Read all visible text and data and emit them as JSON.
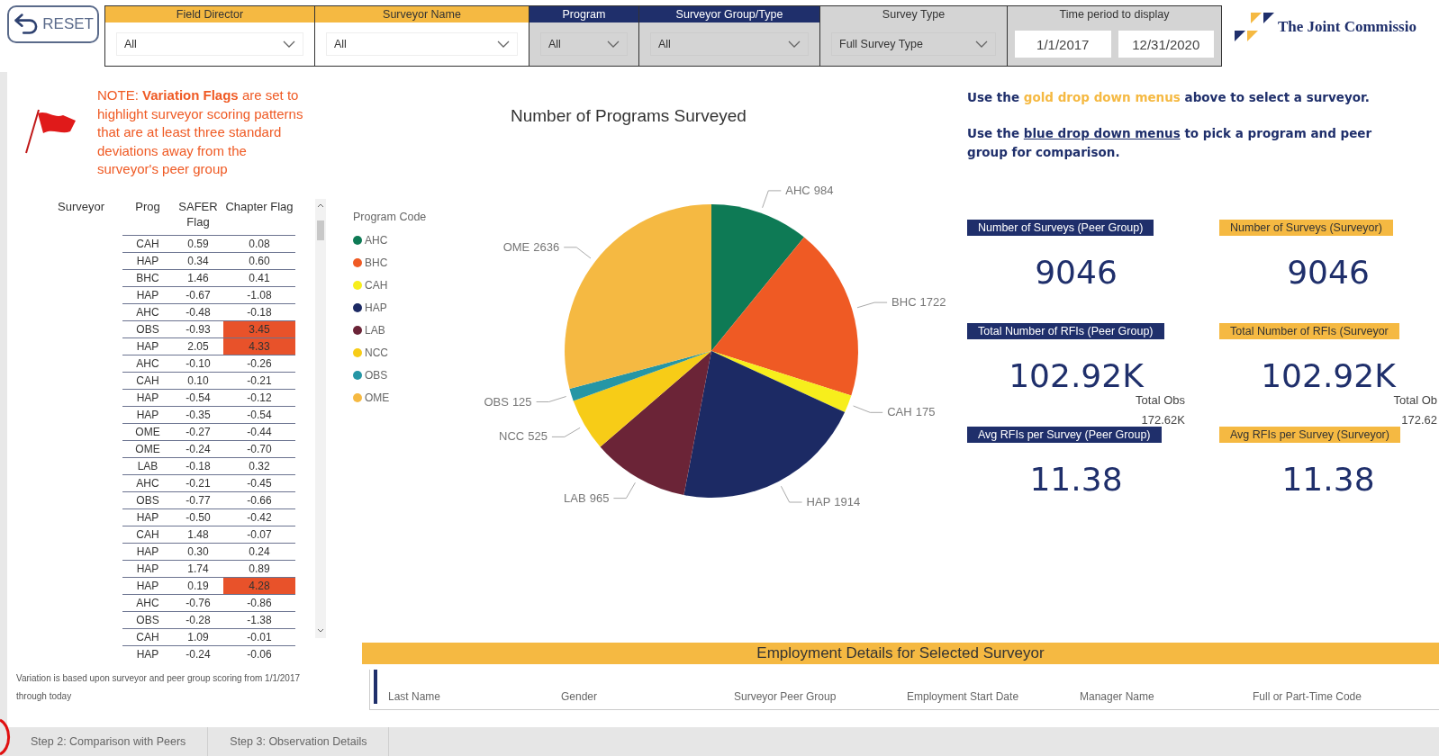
{
  "reset_button": {
    "label": "RESET"
  },
  "filters": [
    {
      "label": "Field Director",
      "kind": "gold",
      "value": "All"
    },
    {
      "label": "Surveyor Name",
      "kind": "gold",
      "value": "All"
    },
    {
      "label": "Program",
      "kind": "blue",
      "value": "All"
    },
    {
      "label": "Surveyor Group/Type",
      "kind": "blue",
      "value": "All"
    },
    {
      "label": "Survey Type",
      "kind": "plain",
      "value": "Full Survey Type"
    }
  ],
  "time_period": {
    "label": "Time period to display",
    "start": "1/1/2017",
    "end": "12/31/2020"
  },
  "logo": {
    "text": "The Joint Commissio"
  },
  "note": {
    "text": "NOTE: **Variation Flags** are set to highlight surveyor scoring patterns that are at least three standard deviations away from the surveyor's peer group"
  },
  "flag_table": {
    "columns": [
      "Surveyor",
      "Prog",
      "SAFER Flag",
      "Chapter Flag"
    ],
    "rows": [
      {
        "prog": "CAH",
        "safer": "0.59",
        "chapter": "0.08",
        "chapter_flagged": false
      },
      {
        "prog": "HAP",
        "safer": "0.34",
        "chapter": "0.60",
        "chapter_flagged": false
      },
      {
        "prog": "BHC",
        "safer": "1.46",
        "chapter": "0.41",
        "chapter_flagged": false
      },
      {
        "prog": "HAP",
        "safer": "-0.67",
        "chapter": "-1.08",
        "chapter_flagged": false
      },
      {
        "prog": "AHC",
        "safer": "-0.48",
        "chapter": "-0.18",
        "chapter_flagged": false
      },
      {
        "prog": "OBS",
        "safer": "-0.93",
        "chapter": "3.45",
        "chapter_flagged": true
      },
      {
        "prog": "HAP",
        "safer": "2.05",
        "chapter": "4.33",
        "chapter_flagged": true
      },
      {
        "prog": "AHC",
        "safer": "-0.10",
        "chapter": "-0.26",
        "chapter_flagged": false
      },
      {
        "prog": "CAH",
        "safer": "0.10",
        "chapter": "-0.21",
        "chapter_flagged": false
      },
      {
        "prog": "HAP",
        "safer": "-0.54",
        "chapter": "-0.12",
        "chapter_flagged": false
      },
      {
        "prog": "HAP",
        "safer": "-0.35",
        "chapter": "-0.54",
        "chapter_flagged": false
      },
      {
        "prog": "OME",
        "safer": "-0.27",
        "chapter": "-0.44",
        "chapter_flagged": false
      },
      {
        "prog": "OME",
        "safer": "-0.24",
        "chapter": "-0.70",
        "chapter_flagged": false
      },
      {
        "prog": "LAB",
        "safer": "-0.18",
        "chapter": "0.32",
        "chapter_flagged": false
      },
      {
        "prog": "AHC",
        "safer": "-0.21",
        "chapter": "-0.45",
        "chapter_flagged": false
      },
      {
        "prog": "OBS",
        "safer": "-0.77",
        "chapter": "-0.66",
        "chapter_flagged": false
      },
      {
        "prog": "HAP",
        "safer": "-0.50",
        "chapter": "-0.42",
        "chapter_flagged": false
      },
      {
        "prog": "CAH",
        "safer": "1.48",
        "chapter": "-0.07",
        "chapter_flagged": false
      },
      {
        "prog": "HAP",
        "safer": "0.30",
        "chapter": "0.24",
        "chapter_flagged": false
      },
      {
        "prog": "HAP",
        "safer": "1.74",
        "chapter": "0.89",
        "chapter_flagged": false
      },
      {
        "prog": "HAP",
        "safer": "0.19",
        "chapter": "4.28",
        "chapter_flagged": true
      },
      {
        "prog": "AHC",
        "safer": "-0.76",
        "chapter": "-0.86",
        "chapter_flagged": false
      },
      {
        "prog": "OBS",
        "safer": "-0.28",
        "chapter": "-1.38",
        "chapter_flagged": false
      },
      {
        "prog": "CAH",
        "safer": "1.09",
        "chapter": "-0.01",
        "chapter_flagged": false
      },
      {
        "prog": "HAP",
        "safer": "-0.24",
        "chapter": "-0.06",
        "chapter_flagged": false
      }
    ]
  },
  "footnote": "Variation is based upon surveyor and peer group scoring from 1/1/2017 through today",
  "chart": {
    "legend_title": "Program Code",
    "legend": [
      {
        "label": "AHC",
        "color": "#0e7a55"
      },
      {
        "label": "BHC",
        "color": "#ef5a24"
      },
      {
        "label": "CAH",
        "color": "#f7ee1c"
      },
      {
        "label": "HAP",
        "color": "#1c2a64"
      },
      {
        "label": "LAB",
        "color": "#6b2437"
      },
      {
        "label": "NCC",
        "color": "#f7cc17"
      },
      {
        "label": "OBS",
        "color": "#2596a5"
      },
      {
        "label": "OME",
        "color": "#f5b942"
      }
    ],
    "chart_data": {
      "type": "pie",
      "title": "Number of Programs Surveyed",
      "categories": [
        "AHC",
        "BHC",
        "CAH",
        "HAP",
        "LAB",
        "NCC",
        "OBS",
        "OME"
      ],
      "values": [
        984,
        1722,
        175,
        1914,
        965,
        525,
        125,
        2636
      ],
      "data_labels": true
    }
  },
  "instructions": [
    {
      "parts": [
        {
          "kind": "plain",
          "text": "Use the "
        },
        {
          "kind": "gold",
          "text": "gold drop down menus"
        },
        {
          "kind": "plain",
          "text": " above to select a surveyor."
        }
      ]
    },
    {
      "parts": [
        {
          "kind": "plain",
          "text": "Use the "
        },
        {
          "kind": "link",
          "text": "blue drop down menus"
        },
        {
          "kind": "plain",
          "text": " to pick a program and peer group for comparison."
        }
      ]
    }
  ],
  "kpis": [
    {
      "label": "Number of Surveys (Peer Group)",
      "kind": "peer",
      "value": "9046"
    },
    {
      "label": "Number of Surveys (Surveyor)",
      "kind": "surveyor",
      "value": "9046"
    },
    {
      "label": "Total Number of RFIs (Peer Group)",
      "kind": "peer",
      "value": "102.92K",
      "sub_label": "Total Obs",
      "sub_value": "172.62K"
    },
    {
      "label": "Total Number of RFIs (Surveyor",
      "kind": "surveyor",
      "value": "102.92K",
      "sub_label": "Total Ob",
      "sub_value": "172.62"
    },
    {
      "label": "Avg RFIs per Survey (Peer Group)",
      "kind": "peer",
      "value": "11.38"
    },
    {
      "label": "Avg RFIs per Survey (Surveyor)",
      "kind": "surveyor",
      "value": "11.38"
    }
  ],
  "employment": {
    "title": "Employment Details for Selected Surveyor",
    "columns": [
      "Last Name",
      "Gender",
      "Surveyor Peer Group",
      "Employment Start Date",
      "Manager Name",
      "Full or Part-Time Code"
    ]
  },
  "tabs": [
    {
      "label": "Step 2: Comparison with Peers",
      "selected": false
    },
    {
      "label": "Step 3: Observation Details",
      "selected": false
    }
  ]
}
